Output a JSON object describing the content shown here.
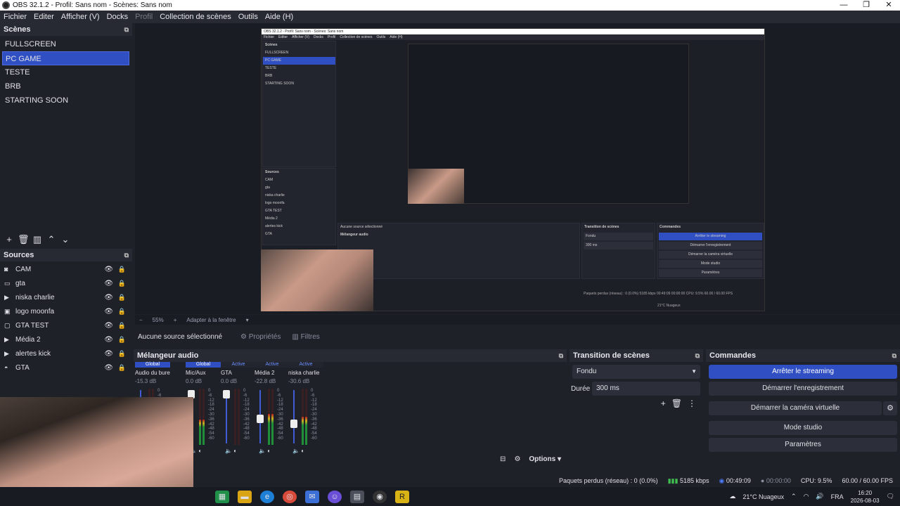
{
  "titlebar": {
    "title": "OBS 32.1.2 - Profil: Sans nom - Scènes: Sans nom",
    "minimize": "—",
    "restore": "❐",
    "close": "✕"
  },
  "menu": [
    {
      "label": "Fichier",
      "disabled": false
    },
    {
      "label": "Editer",
      "disabled": false
    },
    {
      "label": "Afficher (V)",
      "disabled": false
    },
    {
      "label": "Docks",
      "disabled": false
    },
    {
      "label": "Profil",
      "disabled": true
    },
    {
      "label": "Collection de scènes",
      "disabled": false
    },
    {
      "label": "Outils",
      "disabled": false
    },
    {
      "label": "Aide (H)",
      "disabled": false
    }
  ],
  "scenes": {
    "title": "Scènes",
    "items": [
      "FULLSCREEN",
      "PC GAME",
      "TESTE",
      "BRB",
      "STARTING SOON"
    ],
    "selected_index": 1
  },
  "sources": {
    "title": "Sources",
    "items": [
      {
        "label": "CAM",
        "icon": "camera-icon"
      },
      {
        "label": "gta",
        "icon": "monitor-icon"
      },
      {
        "label": "niska charlie",
        "icon": "play-icon"
      },
      {
        "label": "logo moonfa",
        "icon": "image-icon"
      },
      {
        "label": "GTA TEST",
        "icon": "window-icon"
      },
      {
        "label": "Média 2",
        "icon": "play-icon"
      },
      {
        "label": "alertes kick",
        "icon": "play-icon"
      },
      {
        "label": "GTA",
        "icon": "gamepad-icon"
      }
    ]
  },
  "preview_footer": {
    "zoom": "55%",
    "fit": "Adapter à la fenêtre"
  },
  "context": {
    "no_source": "Aucune source sélectionné",
    "properties": "Propriétés",
    "filters": "Filtres"
  },
  "mixer": {
    "title": "Mélangeur audio",
    "channels": [
      {
        "status": "Global",
        "name": "Audio du bureau",
        "db": "-15.3 dB",
        "fader": 0.0,
        "level": 0.0
      },
      {
        "status": "Global",
        "name": "Mic/Aux",
        "db": "0.0 dB",
        "fader": 1.0,
        "level": 0.45
      },
      {
        "status": "Active",
        "name": "GTA",
        "db": "0.0 dB",
        "fader": 1.0,
        "level": 0.0
      },
      {
        "status": "Active",
        "name": "Média 2",
        "db": "-22.8 dB",
        "fader": 0.45,
        "level": 0.55
      },
      {
        "status": "Active",
        "name": "niska charlie",
        "db": "-30.6 dB",
        "fader": 0.35,
        "level": 0.5
      }
    ],
    "scale": [
      "0",
      "-6",
      "-12",
      "-18",
      "-24",
      "-30",
      "-36",
      "-42",
      "-48",
      "-54",
      "-60"
    ],
    "options": "Options"
  },
  "transitions": {
    "title": "Transition de scènes",
    "type": "Fondu",
    "duration_label": "Durée",
    "duration": "300 ms"
  },
  "controls": {
    "title": "Commandes",
    "stop_streaming": "Arrêter le streaming",
    "start_recording": "Démarrer l'enregistrement",
    "start_virtualcam": "Démarrer la caméra virtuelle",
    "studio_mode": "Mode studio",
    "settings": "Paramètres"
  },
  "status": {
    "dropped": "Paquets perdus (réseau) : 0 (0.0%)",
    "bitrate": "5185 kbps",
    "stream_time": "00:49:09",
    "rec_time": "00:00:00",
    "cpu": "CPU: 9.5%",
    "fps": "60.00 / 60.00 FPS"
  },
  "taskbar": {
    "weather": "21°C  Nuageux",
    "lang": "FRA",
    "time": "16:20",
    "date": "2026-08-03"
  },
  "nested": {
    "title": "OBS 32.1.2 - Profil: Sans nom - Scènes: Sans nom",
    "menu": [
      "Fichier",
      "Editer",
      "Afficher (V)",
      "Docks",
      "Profil",
      "Collection de scènes",
      "Outils",
      "Aide (H)"
    ],
    "scenes_title": "Scènes",
    "scenes": [
      "FULLSCREEN",
      "PC GAME",
      "TESTE",
      "BRB",
      "STARTING SOON"
    ],
    "sources_title": "Sources",
    "sources": [
      "CAM",
      "gta",
      "niska charlie",
      "logo moonfa",
      "GTA TEST",
      "Média 2",
      "alertes kick",
      "GTA"
    ],
    "no_source": "Aucune source sélectionné",
    "mixer_title": "Mélangeur audio",
    "trans_title": "Transition de scènes",
    "trans_type": "Fondu",
    "trans_duration": "300 ms",
    "controls_title": "Commandes",
    "buttons": [
      "Arrêter le streaming",
      "Démarrer l'enregistrement",
      "Démarrer la caméra virtuelle",
      "Mode studio",
      "Paramètres"
    ],
    "status": "Paquets perdus (réseau) : 0 (0.0%)   5185 kbps   00:49:09   00:00:00   CPU: 9.5%   60.00 / 60.00 FPS",
    "weather": "21°C  Nuageux"
  },
  "colors": {
    "accent": "#2f4fc3",
    "panel": "#1f2129",
    "header": "#272a33"
  }
}
